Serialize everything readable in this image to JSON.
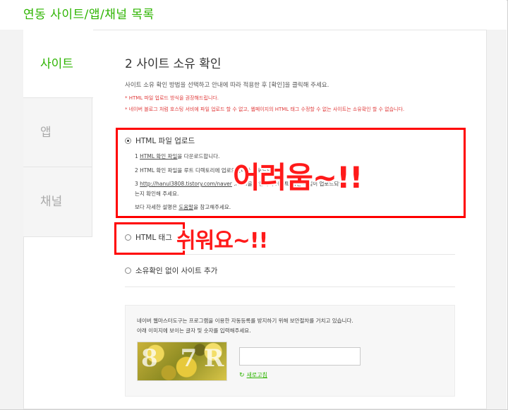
{
  "header": {
    "title": "연동 사이트/앱/채널 목록"
  },
  "tabs": [
    {
      "label": "사이트"
    },
    {
      "label": "앱"
    },
    {
      "label": "채널"
    }
  ],
  "step": {
    "title": "2 사이트 소유 확인",
    "description": "사이트 소유 확인 방법을 선택하고 안내에 따라 적용한 후 [확인]을 클릭해 주세요.",
    "notice1": "* HTML 파일 업로드 방식을 권장해드립니다.",
    "notice2": "* 네이버 블로그 처럼 호스팅 서비에 파일 업로드 할 수 없고, 웹페이지의 HTML 태그 수정할 수 없는 사이트는 소유확인 할 수 없습니다."
  },
  "options": {
    "html_file": {
      "label": "HTML 파일 업로드",
      "step1_prefix": "1 ",
      "step1_link": "HTML 확인 파일",
      "step1_suffix": "을 다운로드합니다.",
      "step2": "2 HTML 확인 파일을 루트 디렉토리에 업로드합니다                                                    운로드합니다.",
      "step3_prefix": "3 ",
      "step3_link": "http://hanul3808.tistory.com/naver",
      "step3_suffix": "                                             .html을 방문하여 HTML 확인 파일이 업로드되었",
      "step3_cont": "는지 확인해 주세요.",
      "more_prefix": "보다 자세한 설명은 ",
      "more_link": "도움말",
      "more_suffix": "을 참고해주세요."
    },
    "html_tag": {
      "label": "HTML 태그"
    },
    "no_verify": {
      "label": "소유확인 없이 사이트 추가"
    }
  },
  "annotations": {
    "hard": "어려움~!!",
    "easy": "쉬워요~!!"
  },
  "captcha": {
    "desc1": "네이버 웹마스터도구는 프로그램을 이용한 자동등록를 방지하기 위해 보안절차를 거치고 있습니다.",
    "desc2": "아래 이미지에 보이는 글자 및 숫자를 입력해주세요.",
    "image_text": "8 7R",
    "input_value": "",
    "refresh_label": "새로고침"
  },
  "colors": {
    "accent": "#2db400",
    "annotation_red": "#ff0000",
    "notice_red": "#e03b3b"
  }
}
